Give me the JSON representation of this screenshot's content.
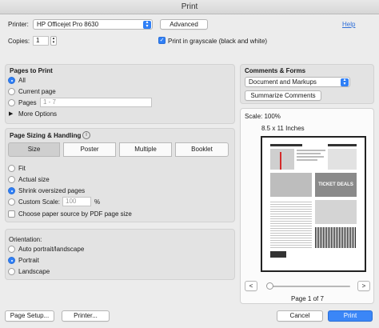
{
  "window": {
    "title": "Print"
  },
  "printer": {
    "label": "Printer:",
    "value": "HP Officejet Pro 8630",
    "advanced_label": "Advanced",
    "help_label": "Help"
  },
  "copies": {
    "label": "Copies:",
    "value": "1",
    "grayscale_label": "Print in grayscale (black and white)",
    "grayscale_checked": true
  },
  "pages_to_print": {
    "title": "Pages to Print",
    "options": [
      "All",
      "Current page",
      "Pages"
    ],
    "selected": "All",
    "pages_placeholder": "1 - 7",
    "more_options_label": "More Options"
  },
  "page_sizing": {
    "title": "Page Sizing & Handling",
    "tabs": [
      "Size",
      "Poster",
      "Multiple",
      "Booklet"
    ],
    "active_tab": "Size",
    "options": [
      "Fit",
      "Actual size",
      "Shrink oversized pages",
      "Custom Scale:"
    ],
    "selected": "Shrink oversized pages",
    "custom_scale_value": "100",
    "percent": "%",
    "paper_source_label": "Choose paper source by PDF page size"
  },
  "orientation": {
    "title": "Orientation:",
    "options": [
      "Auto portrait/landscape",
      "Portrait",
      "Landscape"
    ],
    "selected": "Portrait"
  },
  "comments_forms": {
    "title": "Comments & Forms",
    "value": "Document and Markups",
    "summarize_label": "Summarize Comments"
  },
  "preview": {
    "scale_label": "Scale: 100%",
    "paper_size": "8.5 x 11 Inches",
    "page_indicator": "Page 1 of 7",
    "prev_label": "<",
    "next_label": ">",
    "ticket_headline": "TICKET DEALS"
  },
  "footer": {
    "page_setup_label": "Page Setup...",
    "printer_label": "Printer...",
    "cancel_label": "Cancel",
    "print_label": "Print"
  },
  "colors": {
    "accent": "#2f7ff6"
  }
}
